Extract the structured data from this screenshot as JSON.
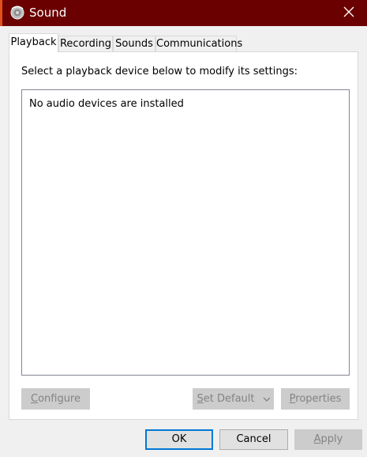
{
  "window": {
    "title": "Sound",
    "icon": "speaker-icon",
    "close_icon": "close-icon",
    "titlebar_color": "#6b0000"
  },
  "tabs": [
    {
      "label": "Playback",
      "active": true
    },
    {
      "label": "Recording",
      "active": false
    },
    {
      "label": "Sounds",
      "active": false
    },
    {
      "label": "Communications",
      "active": false
    }
  ],
  "playback": {
    "instruction": "Select a playback device below to modify its settings:",
    "empty_message": "No audio devices are installed",
    "buttons": {
      "configure": {
        "mnemonic": "C",
        "rest": "onfigure",
        "enabled": false
      },
      "set_default": {
        "mnemonic": "S",
        "rest": "et Default",
        "enabled": false
      },
      "properties": {
        "mnemonic": "P",
        "rest": "roperties",
        "enabled": false
      }
    }
  },
  "footer": {
    "ok": {
      "label": "OK",
      "enabled": true
    },
    "cancel": {
      "label": "Cancel",
      "enabled": true
    },
    "apply": {
      "mnemonic": "A",
      "rest": "pply",
      "enabled": false
    }
  },
  "colors": {
    "focus_border": "#0078d7",
    "disabled_text": "#838383"
  }
}
